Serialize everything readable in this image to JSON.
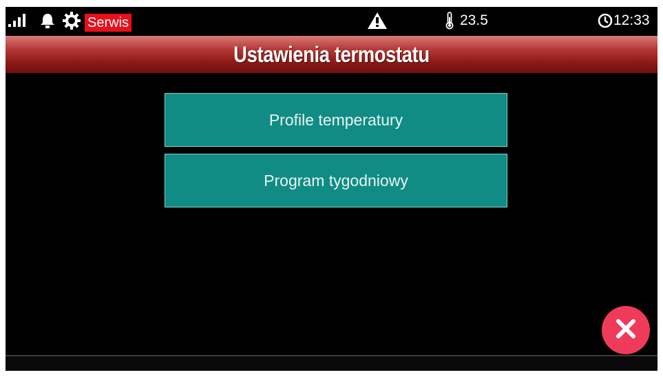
{
  "status_bar": {
    "service_label": "Serwis",
    "temperature": "23.5",
    "time": "12:33",
    "icons": {
      "signal": "signal-strength-icon",
      "bell": "bell-icon",
      "gear": "gear-icon",
      "warning": "warning-icon",
      "thermometer": "thermometer-icon",
      "clock": "clock-icon"
    }
  },
  "header": {
    "title": "Ustawienia termostatu"
  },
  "menu": {
    "items": [
      {
        "label": "Profile temperatury"
      },
      {
        "label": "Program tygodniowy"
      }
    ]
  },
  "actions": {
    "close_icon": "close-icon"
  },
  "colors": {
    "service_badge": "#e8101a",
    "menu_button": "#108c84",
    "menu_border": "#7fd6cc",
    "title_bar": "#9a2220",
    "close_button": "#f03a5a"
  }
}
